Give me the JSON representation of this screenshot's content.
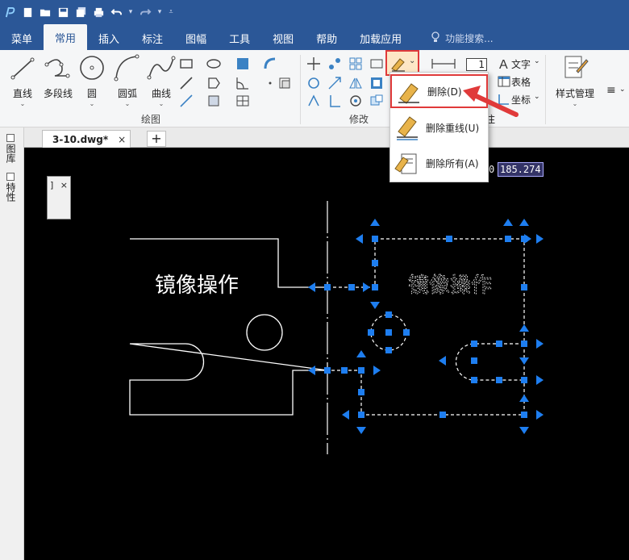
{
  "menu": {
    "tabs": [
      "菜单",
      "常用",
      "插入",
      "标注",
      "图幅",
      "工具",
      "视图",
      "帮助",
      "加载应用"
    ],
    "active_tab": "常用",
    "search_placeholder": "功能搜索..."
  },
  "ribbon": {
    "draw": {
      "group_label": "绘图",
      "line": "直线",
      "polyline": "多段线",
      "circle": "圆",
      "arc": "圆弧",
      "curve": "曲线"
    },
    "modify": {
      "group_label": "修改"
    },
    "annotate": {
      "text": "文字",
      "table": "表格",
      "coord": "坐标",
      "frag": "注"
    },
    "style": {
      "label": "样式管理"
    },
    "num_box": "1"
  },
  "dropdown": {
    "items": [
      {
        "label": "删除(D)"
      },
      {
        "label": "删除重线(U)"
      },
      {
        "label": "删除所有(A)"
      }
    ]
  },
  "dock": {
    "tab1": "图库",
    "tab2": "特性"
  },
  "document": {
    "tab_name": "3-10.dwg*",
    "close_glyph": "×",
    "new_tab": "+"
  },
  "canvas": {
    "coord_left": "0",
    "coord_right": "185.274",
    "mini_panel_left": "]",
    "mini_panel_close": "×",
    "original_text": "镜像操作",
    "mirrored_text": "镜像操作"
  },
  "colors": {
    "title_blue": "#2b5797",
    "grip_blue": "#1e7ef0",
    "highlight_red": "#e03a3a"
  }
}
